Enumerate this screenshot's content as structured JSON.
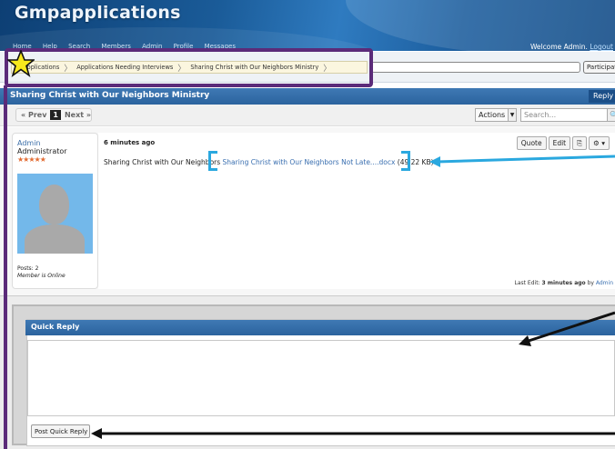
{
  "header": {
    "site_title": "Gmpapplications",
    "nav_items": [
      "Home",
      "Help",
      "Search",
      "Members",
      "Admin",
      "Profile",
      "Messages"
    ],
    "welcome_text": "Welcome Admin.",
    "logout_label": "Logout"
  },
  "breadcrumbs": {
    "items": [
      "Applications",
      "Applications Needing Interviews",
      "Sharing Christ with Our Neighbors Ministry"
    ],
    "participate_label": "Participate"
  },
  "thread": {
    "title": "Sharing Christ with Our Neighbors Ministry",
    "reply_label": "Reply"
  },
  "pagination": {
    "prev_label": "« Prev",
    "current_page": "1",
    "next_label": "Next »",
    "actions_label": "Actions",
    "search_placeholder": "Search..."
  },
  "post": {
    "user": {
      "name": "Admin",
      "role": "Administrator",
      "stars": "★★★★★",
      "posts": "Posts: 2",
      "status": "Member is Online"
    },
    "time": "6 minutes ago",
    "text_prefix": "Sharing Christ with Our Neighbors",
    "attachment_name": "Sharing Christ with Our Neighbors Not Late....docx",
    "attachment_size": "(49.22 KB)",
    "tools": {
      "quote": "Quote",
      "edit": "Edit"
    },
    "last_edit_label": "Last Edit:",
    "last_edit_time": "3 minutes ago",
    "last_edit_by_prefix": "by",
    "last_edit_by": "Admin"
  },
  "quick_reply": {
    "title": "Quick Reply",
    "submit_label": "Post Quick Reply"
  },
  "colors": {
    "annotation_purple": "#5b2b79",
    "annotation_blue": "#2aa8df",
    "header_blue": "#1a5b98"
  }
}
